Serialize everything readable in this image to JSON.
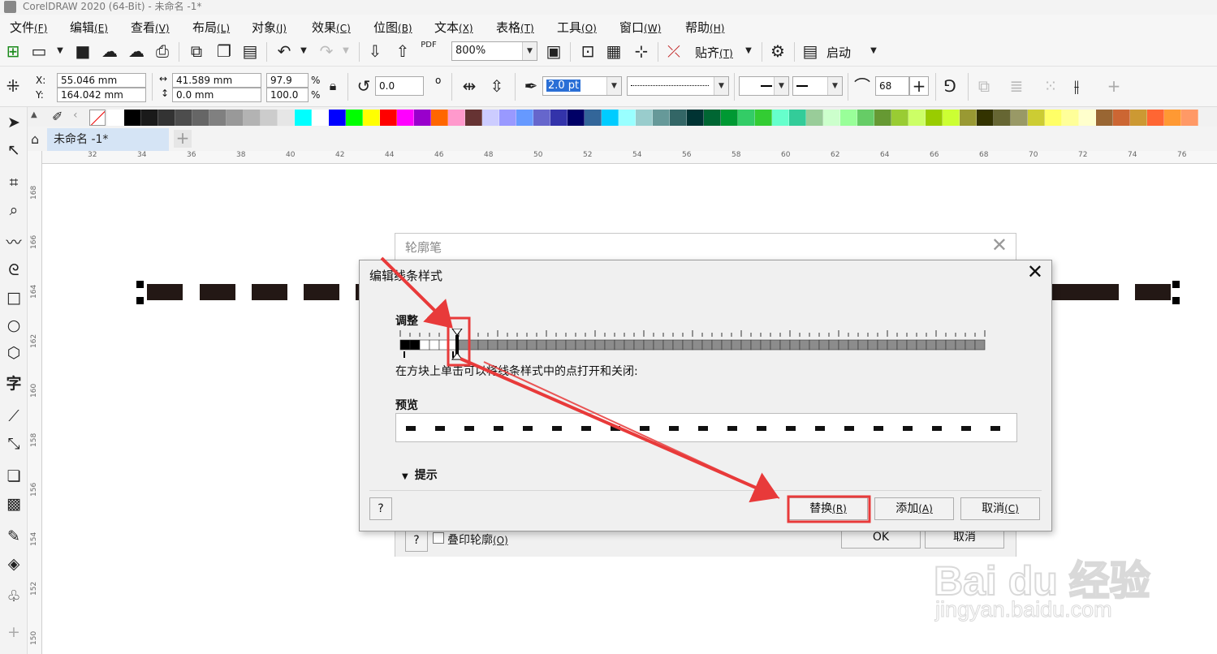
{
  "app": {
    "title": "CorelDRAW 2020 (64-Bit) - 未命名 -1*"
  },
  "menu": [
    {
      "label": "文件",
      "acc": "(F)"
    },
    {
      "label": "编辑",
      "acc": "(E)"
    },
    {
      "label": "查看",
      "acc": "(V)"
    },
    {
      "label": "布局",
      "acc": "(L)"
    },
    {
      "label": "对象",
      "acc": "(J)"
    },
    {
      "label": "效果",
      "acc": "(C)"
    },
    {
      "label": "位图",
      "acc": "(B)"
    },
    {
      "label": "文本",
      "acc": "(X)"
    },
    {
      "label": "表格",
      "acc": "(T)"
    },
    {
      "label": "工具",
      "acc": "(O)"
    },
    {
      "label": "窗口",
      "acc": "(W)"
    },
    {
      "label": "帮助",
      "acc": "(H)"
    }
  ],
  "toolbar": {
    "zoom": "800%",
    "snap_label": "贴齐",
    "snap_acc": "(T)",
    "launch_label": "启动",
    "pdf_label": "PDF"
  },
  "property_bar": {
    "x_label": "X:",
    "y_label": "Y:",
    "x_value": "55.046 mm",
    "y_value": "164.042 mm",
    "width_value": "41.589 mm",
    "height_value": "0.0 mm",
    "scale_x": "97.9",
    "scale_y": "100.0",
    "percent": "%",
    "rotation": "0.0",
    "degree": "o",
    "outline_width": "2.0 pt",
    "smoothing": "68"
  },
  "palette_colors": [
    "#ffffff",
    "#000000",
    "#1a1a1a",
    "#333333",
    "#4d4d4d",
    "#666666",
    "#808080",
    "#999999",
    "#b3b3b3",
    "#cccccc",
    "#e6e6e6",
    "#00ffff",
    "#ffffff",
    "#0000ff",
    "#00ff00",
    "#ffff00",
    "#ff0000",
    "#ff00ff",
    "#9900cc",
    "#ff6600",
    "#ff99cc",
    "#663333",
    "#ccccff",
    "#9999ff",
    "#6699ff",
    "#6666cc",
    "#3333aa",
    "#000066",
    "#336699",
    "#00ccff",
    "#99ffff",
    "#99cccc",
    "#669999",
    "#336666",
    "#003333",
    "#006633",
    "#009933",
    "#33cc66",
    "#33cc33",
    "#66ffcc",
    "#33cc99",
    "#99cc99",
    "#ccffcc",
    "#99ff99",
    "#66cc66",
    "#669933",
    "#99cc33",
    "#ccff66",
    "#99cc00",
    "#ccff33",
    "#999933",
    "#333300",
    "#666633",
    "#999966",
    "#cccc33",
    "#ffff66",
    "#ffff99",
    "#ffffcc",
    "#996633",
    "#cc6633",
    "#cc9933",
    "#ff6633",
    "#ff9933",
    "#ff9966"
  ],
  "tab": {
    "doc_name": "未命名 -1*",
    "add": "+"
  },
  "ruler": {
    "h_ticks": [
      "32",
      "34",
      "36",
      "38",
      "40",
      "42",
      "44",
      "46",
      "48",
      "50",
      "52",
      "54",
      "56",
      "58",
      "60",
      "62",
      "64",
      "66",
      "68",
      "70",
      "72",
      "74",
      "76"
    ],
    "v_ticks": [
      "168",
      "166",
      "164",
      "162",
      "160",
      "158",
      "156",
      "154",
      "152",
      "150"
    ]
  },
  "back_dialog": {
    "title": "轮廓笔",
    "help": "?",
    "overprint_label": "叠印轮廓",
    "overprint_acc": "(O)",
    "ok_label": "OK",
    "cancel_label": "取消"
  },
  "front_dialog": {
    "title": "编辑线条样式",
    "adjust_label": "调整",
    "hint_text": "在方块上单击可以将线条样式中的点打开和关闭:",
    "preview_label": "预览",
    "tips_label": "提示",
    "help": "?",
    "replace_label": "替换",
    "replace_acc": "(R)",
    "add_label": "添加",
    "add_acc": "(A)",
    "cancel_label": "取消",
    "cancel_acc": "(C)"
  },
  "watermark": {
    "line1": "Bai du 经验",
    "line2": "jingyan.baidu.com"
  },
  "colors": {
    "annotation_red": "#e83a3a",
    "tab_blue": "#d5e4f5",
    "dash_color": "#231815"
  }
}
